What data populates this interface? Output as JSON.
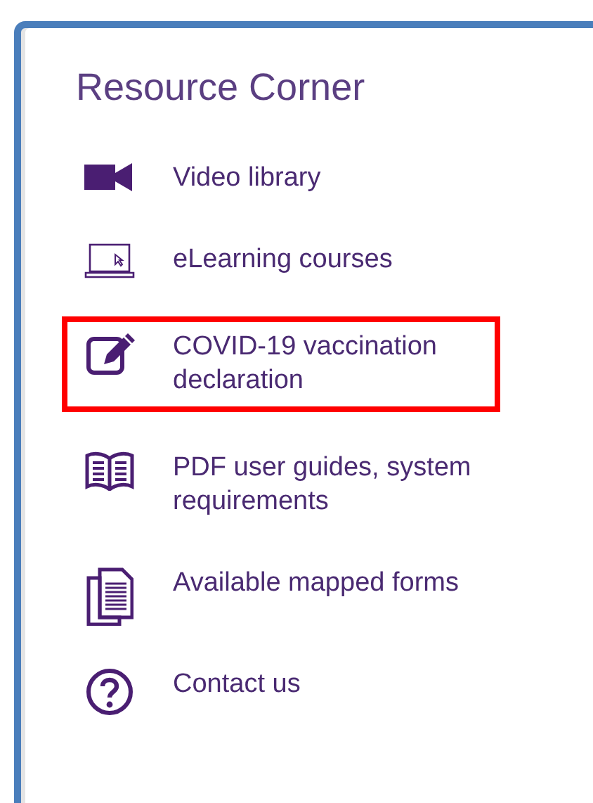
{
  "panel": {
    "title": "Resource Corner",
    "items": [
      {
        "label": "Video library",
        "highlighted": false
      },
      {
        "label": "eLearning courses",
        "highlighted": false
      },
      {
        "label": "COVID-19 vaccination declaration",
        "highlighted": true
      },
      {
        "label": "PDF user guides, system requirements",
        "highlighted": false
      },
      {
        "label": "Available mapped forms",
        "highlighted": false
      },
      {
        "label": "Contact us",
        "highlighted": false
      }
    ]
  }
}
